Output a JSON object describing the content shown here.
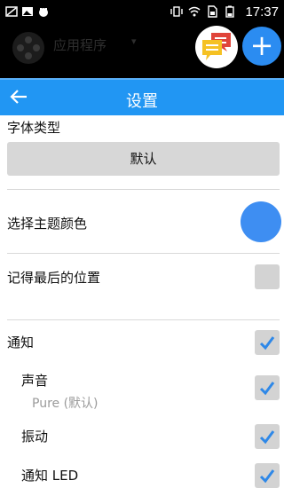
{
  "status_bar": {
    "time": "17:37",
    "left_icons": [
      "notification-icon",
      "image-icon",
      "android-icon"
    ],
    "right_icons": [
      "vibrate-icon",
      "wifi-icon",
      "sim-icon",
      "battery-icon"
    ]
  },
  "app_bar": {
    "title": "应用程序",
    "caret": "▾"
  },
  "fab": {
    "add_label": "+",
    "chat_icon": "chat-bubbles-icon",
    "accent_color": "#2b8cf1"
  },
  "settings": {
    "title": "设置",
    "back_icon": "arrow-left-icon",
    "header_color": "#2196f3",
    "font_type": {
      "label": "字体类型",
      "value": "默认"
    },
    "theme_color": {
      "label": "选择主题颜色",
      "color": "#3e8ef2"
    },
    "remember_position": {
      "label": "记得最后的位置",
      "checked": false
    },
    "notification": {
      "label": "通知",
      "checked": true
    },
    "sound": {
      "label": "声音",
      "subtitle": "Pure (默认)",
      "checked": true
    },
    "vibration": {
      "label": "振动",
      "checked": true
    },
    "notify_led": {
      "label": "通知 LED",
      "checked": true
    }
  }
}
